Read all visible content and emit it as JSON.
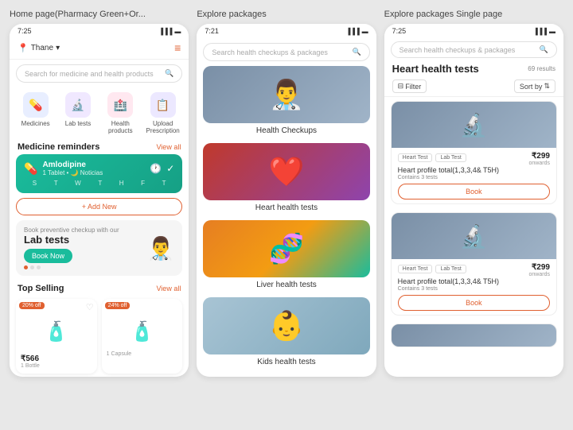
{
  "screens": [
    {
      "title": "Home page(Pharmacy Green+Or...",
      "statusTime": "7:25",
      "header": {
        "location": "Thane",
        "chevron": "▾"
      },
      "searchPlaceholder": "Search for medicine and health products",
      "categories": [
        {
          "label": "Medicines",
          "icon": "💊",
          "bg": "cat-blue"
        },
        {
          "label": "Lab tests",
          "icon": "🔬",
          "bg": "cat-purple"
        },
        {
          "label": "Health products",
          "icon": "🏥",
          "bg": "cat-pink"
        },
        {
          "label": "Upload Prescription",
          "icon": "📋",
          "bg": "cat-indigo"
        }
      ],
      "medicineReminders": {
        "sectionTitle": "Medicine reminders",
        "viewAll": "View all",
        "card": {
          "name": "Amlodipine",
          "detail": "1 Tablet • 🌙 Noticias",
          "days": [
            "S",
            "T",
            "W",
            "T",
            "H",
            "F",
            "T"
          ]
        }
      },
      "addNewLabel": "+ Add New",
      "labBanner": {
        "smallText": "Book preventive checkup with our",
        "title": "Lab tests",
        "bookLabel": "Book Now"
      },
      "topSelling": {
        "sectionTitle": "Top Selling",
        "viewAll": "View all",
        "products": [
          {
            "discount": "20% off",
            "price": "₹566",
            "unit": "1 Bottle"
          },
          {
            "discount": "24% off",
            "price": "",
            "unit": "1 Capsule"
          }
        ]
      }
    },
    {
      "title": "Explore packages",
      "statusTime": "7:21",
      "searchPlaceholder": "Search health checkups & packages",
      "packages": [
        {
          "label": "Health Checkups",
          "imgClass": "pkg-img-1",
          "emoji": "👨‍⚕️"
        },
        {
          "label": "Heart health tests",
          "imgClass": "pkg-img-2",
          "emoji": "❤️"
        },
        {
          "label": "Liver health tests",
          "imgClass": "pkg-img-3",
          "emoji": "🧬"
        },
        {
          "label": "Kids health tests",
          "imgClass": "pkg-img-4",
          "emoji": "👶"
        }
      ]
    },
    {
      "title": "Explore packages Single page",
      "statusTime": "7:25",
      "searchPlaceholder": "Search health checkups & packages",
      "pageTitle": "Heart health tests",
      "results": "69 results",
      "filterLabel": "Filter",
      "sortByLabel": "Sort by",
      "tests": [
        {
          "tags": [
            "Heart Test",
            "Lab Test"
          ],
          "price": "₹299",
          "priceUnit": "onwards",
          "name": "Heart profile total(1,3,3,4& T5H)",
          "desc": "Contains 3 tests",
          "bookLabel": "Book"
        },
        {
          "tags": [
            "Heart Test",
            "Lab Test"
          ],
          "price": "₹299",
          "priceUnit": "onwards",
          "name": "Heart profile total(1,3,3,4& T5H)",
          "desc": "Contains 3 tests",
          "bookLabel": "Book"
        }
      ]
    }
  ]
}
